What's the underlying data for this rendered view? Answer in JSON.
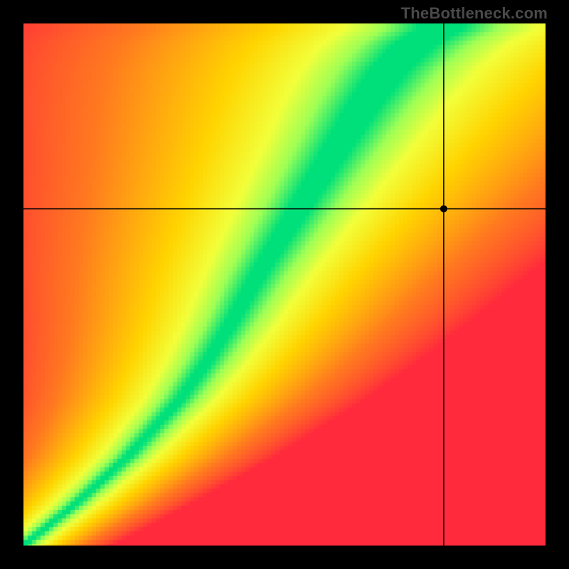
{
  "watermark": "TheBottleneck.com",
  "chart_data": {
    "type": "heatmap",
    "title": "",
    "xlabel": "",
    "ylabel": "",
    "xlim": [
      0,
      100
    ],
    "ylim": [
      0,
      100
    ],
    "grid": false,
    "legend": false,
    "description": "Continuous 2D heatmap. Green ridge marks ideal balance; color shifts through yellow to orange to red as distance from the ridge increases.",
    "ridge_curve": {
      "comment": "Approximate (x,y) path of the green optimum ridge, in 0–100 axis units, bottom-left origin.",
      "points": [
        [
          0,
          0
        ],
        [
          10,
          8
        ],
        [
          20,
          17
        ],
        [
          30,
          28
        ],
        [
          35,
          35
        ],
        [
          40,
          43
        ],
        [
          45,
          52
        ],
        [
          50,
          60
        ],
        [
          55,
          68
        ],
        [
          60,
          76
        ],
        [
          65,
          84
        ],
        [
          70,
          91
        ],
        [
          75,
          96
        ],
        [
          80,
          99
        ]
      ]
    },
    "color_stops": [
      {
        "t": 0.0,
        "color": "#ff2a3c"
      },
      {
        "t": 0.4,
        "color": "#ff7a1f"
      },
      {
        "t": 0.7,
        "color": "#ffd400"
      },
      {
        "t": 0.85,
        "color": "#f2ff3a"
      },
      {
        "t": 0.93,
        "color": "#9fff55"
      },
      {
        "t": 1.0,
        "color": "#00e07a"
      }
    ],
    "marker": {
      "x": 80.5,
      "y": 64.5,
      "comment": "Black crosshair intersection point in 0–100 axis units, bottom-left origin."
    },
    "pixelation": 6
  }
}
